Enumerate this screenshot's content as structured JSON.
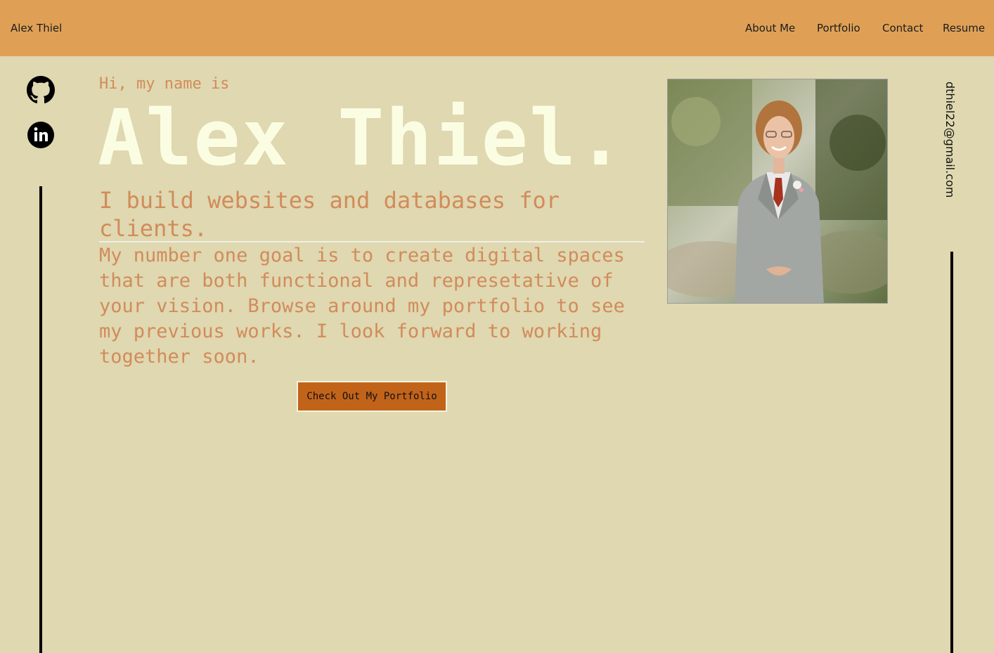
{
  "nav": {
    "brand": "Alex Thiel",
    "links": [
      {
        "label": "About Me"
      },
      {
        "label": "Portfolio"
      },
      {
        "label": "Contact"
      },
      {
        "label": "Resume"
      }
    ]
  },
  "social": [
    {
      "icon": "github-icon"
    },
    {
      "icon": "linkedin-icon"
    }
  ],
  "hero": {
    "greeting": "Hi, my name is",
    "name": "Alex Thiel.",
    "tagline": "I build websites and databases for clients.",
    "description": "My number one goal is to create digital spaces that are both functional and represetative of your vision. Browse around my portfolio to see my previous works. I look forward to working together soon.",
    "cta_label": "Check Out My Portfolio"
  },
  "contact": {
    "email": "dthiel22@gmail.com"
  },
  "colors": {
    "navbar": "#dfa056",
    "background": "#dfd8b0",
    "accent_text": "#d28b5b",
    "name_text": "#fbfde3",
    "button": "#c2631a"
  }
}
